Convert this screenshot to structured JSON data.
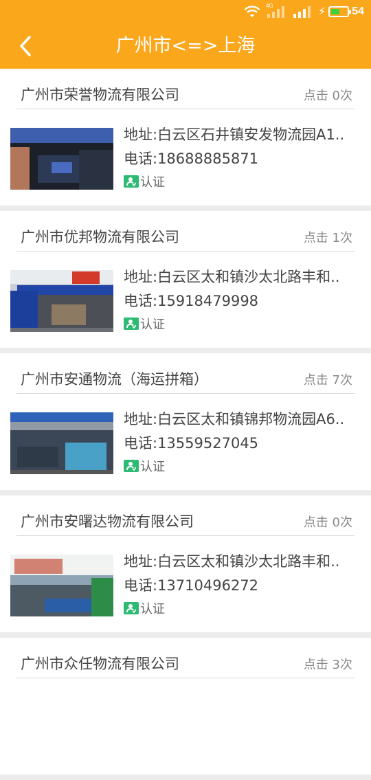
{
  "status_bar": {
    "network_tag": "4G",
    "battery_percent": "54",
    "battery_level": 0.54
  },
  "header": {
    "title": "广州市<=>上海",
    "back_icon": "chevron-left-icon"
  },
  "companies": [
    {
      "name": "广州市荣誉物流有限公司",
      "clicks": "点击 0次",
      "address": "地址:白云区石井镇安发物流园A1..",
      "phone": "电话:18688885871",
      "cert_label": "认证"
    },
    {
      "name": "广州市优邦物流有限公司",
      "clicks": "点击 1次",
      "address": "地址:白云区太和镇沙太北路丰和..",
      "phone": "电话:15918479998",
      "cert_label": "认证"
    },
    {
      "name": "广州市安通物流（海运拼箱）",
      "clicks": "点击 7次",
      "address": "地址:白云区太和镇锦邦物流园A6..",
      "phone": "电话:13559527045",
      "cert_label": "认证"
    },
    {
      "name": "广州市安曙达物流有限公司",
      "clicks": "点击 0次",
      "address": "地址:白云区太和镇沙太北路丰和..",
      "phone": "电话:13710496272",
      "cert_label": "认证"
    },
    {
      "name": "广州市众任物流有限公司",
      "clicks": "点击 3次"
    }
  ],
  "colors": {
    "brand": "#fba71c",
    "cert_green": "#2dba73"
  }
}
